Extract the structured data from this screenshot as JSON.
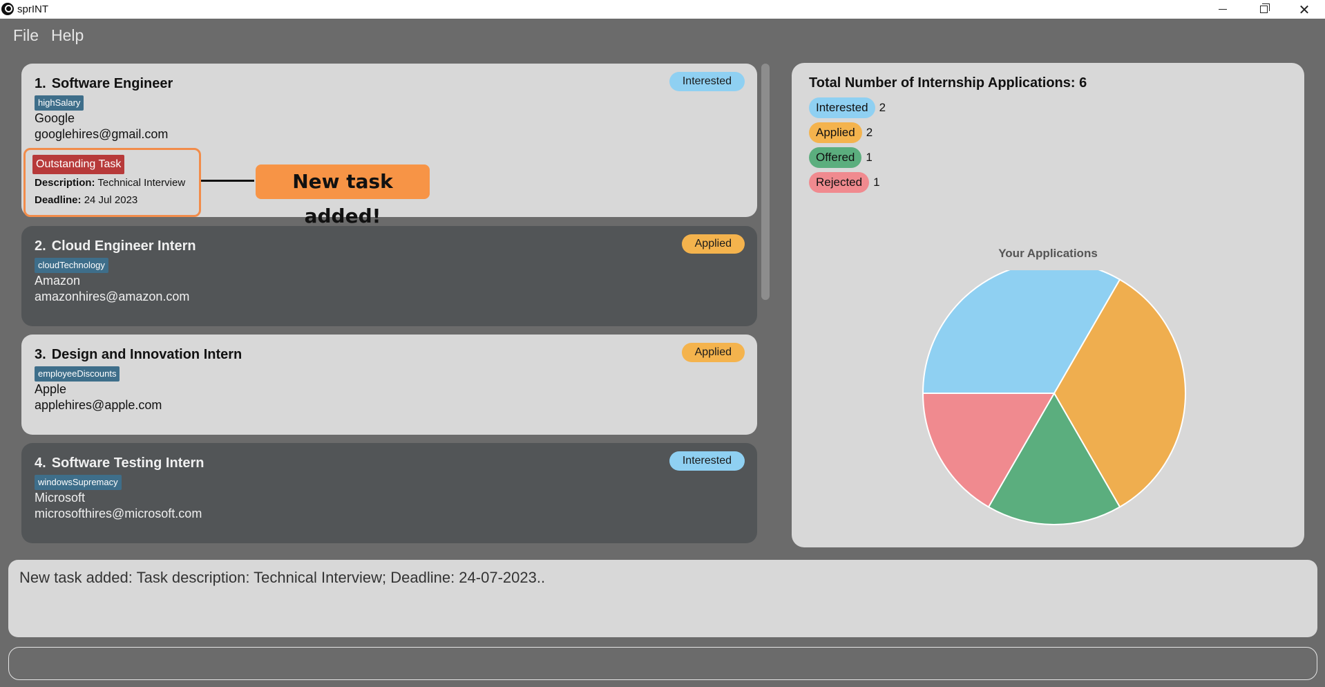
{
  "window": {
    "title": "sprINT",
    "minimize_glyph": "",
    "close_glyph": "✕"
  },
  "menu": {
    "file": "File",
    "help": "Help"
  },
  "applications": [
    {
      "index": "1.",
      "title": "Software Engineer",
      "tag": "highSalary",
      "company": "Google",
      "email": "googlehires@gmail.com",
      "status": "Interested",
      "task": {
        "label": "Outstanding Task",
        "description_label": "Description:",
        "description": "Technical Interview",
        "deadline_label": "Deadline:",
        "deadline": "24 Jul 2023"
      }
    },
    {
      "index": "2.",
      "title": "Cloud Engineer Intern",
      "tag": "cloudTechnology",
      "company": "Amazon",
      "email": "amazonhires@amazon.com",
      "status": "Applied"
    },
    {
      "index": "3.",
      "title": "Design and Innovation Intern",
      "tag": "employeeDiscounts",
      "company": "Apple",
      "email": "applehires@apple.com",
      "status": "Applied"
    },
    {
      "index": "4.",
      "title": "Software Testing Intern",
      "tag": "windowsSupremacy",
      "company": "Microsoft",
      "email": "microsofthires@microsoft.com",
      "status": "Interested"
    }
  ],
  "callout": "New task added!",
  "stats": {
    "title": "Total Number of Internship Applications: 6",
    "legend": [
      {
        "label": "Interested",
        "count": "2",
        "color": "#8fd0f2"
      },
      {
        "label": "Applied",
        "count": "2",
        "color": "#f4b34d"
      },
      {
        "label": "Offered",
        "count": "1",
        "color": "#5bae7e"
      },
      {
        "label": "Rejected",
        "count": "1",
        "color": "#f08a8f"
      }
    ]
  },
  "chart_data": {
    "type": "pie",
    "title": "Your Applications",
    "categories": [
      "Interested",
      "Applied",
      "Offered",
      "Rejected"
    ],
    "values": [
      2,
      2,
      1,
      1
    ],
    "colors": [
      "#8fd0f2",
      "#efae4f",
      "#5bae7e",
      "#f08a8f"
    ]
  },
  "result": {
    "text": "New task added: Task description: Technical Interview; Deadline: 24-07-2023.."
  },
  "command": {
    "value": "",
    "placeholder": ""
  }
}
